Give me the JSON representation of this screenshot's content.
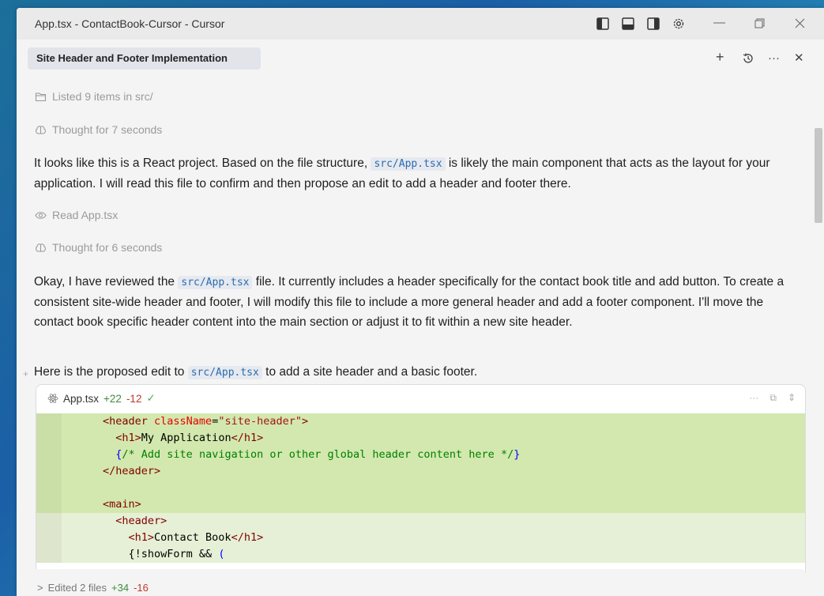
{
  "window": {
    "title": "App.tsx - ContactBook-Cursor - Cursor"
  },
  "chat": {
    "tab_title": "Site Header and Footer Implementation",
    "actions": {
      "new": "+",
      "history": "⟲",
      "more": "···",
      "close": "✕"
    }
  },
  "messages": {
    "status1": "Listed 9 items in src/",
    "status2": "Thought for 7 seconds",
    "para1_a": "It looks like this is a React project. Based on the file structure, ",
    "para1_code": "src/App.tsx",
    "para1_b": " is likely the main component that acts as the layout for your application. I will read this file to confirm and then propose an edit to add a header and footer there.",
    "status3": "Read App.tsx",
    "status4": "Thought for 6 seconds",
    "para2_a": "Okay, I have reviewed the ",
    "para2_code": "src/App.tsx",
    "para2_b": " file. It currently includes a header specifically for the contact book title and add button. To create a consistent site-wide header and footer, I will modify this file to include a more general header and add a footer component. I'll move the contact book specific header content into the main section or adjust it to fit within a new site header.",
    "para3_a": "Here is the proposed edit to ",
    "para3_code": "src/App.tsx",
    "para3_b": " to add a site header and a basic footer."
  },
  "code_block": {
    "file": "App.tsx",
    "added": "+22",
    "removed": "-12",
    "lines": {
      "l1_tag": "<header",
      "l1_attr": " className",
      "l1_eq": "=",
      "l1_str": "\"site-header\"",
      "l1_end": ">",
      "l2_open": "<h1>",
      "l2_text": "My Application",
      "l2_close": "</h1>",
      "l3_b1": "{",
      "l3_cmt": "/* Add site navigation or other global header content here */",
      "l3_b2": "}",
      "l4": "</header>",
      "l6": "<main>",
      "l7": "<header>",
      "l8_open": "<h1>",
      "l8_text": "Contact Book",
      "l8_close": "</h1>",
      "l9_a": "{!showForm && ",
      "l9_b": "("
    }
  },
  "footer": {
    "label": "Edited 2 files",
    "added": "+34",
    "removed": "-16"
  },
  "colors": {
    "added_bg": "#d3e8ae",
    "context_bg": "#e6f0d6",
    "inline_code": "#2b6cb0"
  }
}
